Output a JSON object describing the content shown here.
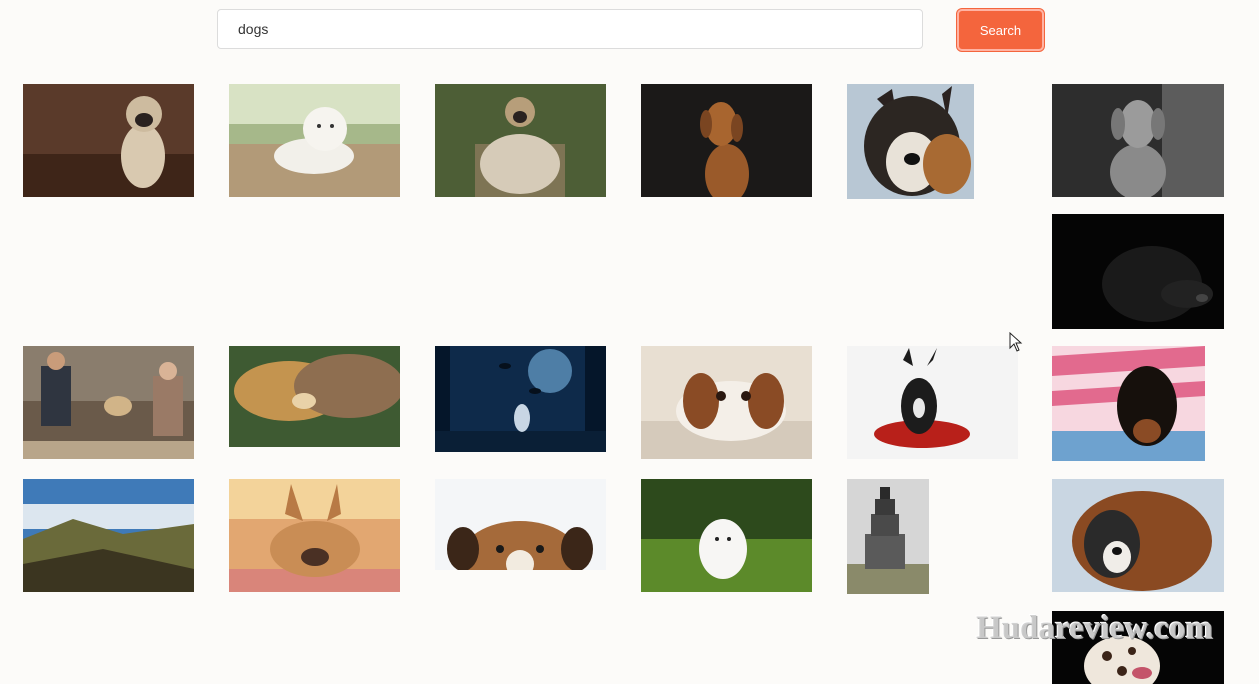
{
  "search": {
    "value": "dogs",
    "button_label": "Search",
    "button_color": "#f4653d"
  },
  "gallery": {
    "photos": [
      {
        "subject": "pug on wooden floor"
      },
      {
        "subject": "white labrador puppy on deck"
      },
      {
        "subject": "pug wrapped in blanket on forest path"
      },
      {
        "subject": "brown vizsla on dark background"
      },
      {
        "subject": "husky close-up"
      },
      {
        "subject": "grey weimaraner puppy"
      },
      {
        "subject": "black dog profile on black background"
      },
      {
        "subject": "couple sitting with dog"
      },
      {
        "subject": "golden dog cuddling with cat"
      },
      {
        "subject": "dog in misty blue forest"
      },
      {
        "subject": "cavalier king charles spaniel lying down"
      },
      {
        "subject": "french bulldog on red pillow"
      },
      {
        "subject": "dachshund puppy on striped blanket"
      },
      {
        "subject": "dog in mountain landscape"
      },
      {
        "subject": "french bulldog lying in warm light"
      },
      {
        "subject": "dog peeking over edge"
      },
      {
        "subject": "white fluffy puppy on grass"
      },
      {
        "subject": "bremen town musicians animal statue"
      },
      {
        "subject": "saint bernard in snow"
      },
      {
        "subject": "dalmatian on black background"
      }
    ]
  },
  "watermark": {
    "text": "Hudareview.com"
  }
}
